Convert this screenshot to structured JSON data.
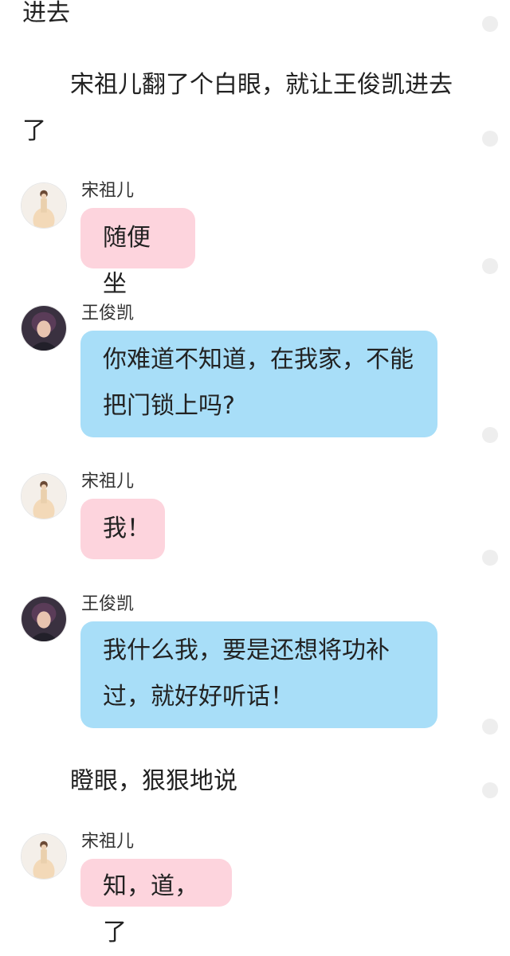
{
  "narration": [
    "进去",
    "宋祖儿翻了个白眼，就让王俊凯进去",
    "了",
    "瞪眼，狠狠地说"
  ],
  "messages": [
    {
      "speaker": "宋祖儿",
      "text": "随便坐"
    },
    {
      "speaker": "王俊凯",
      "text_lines": [
        "你难道不知道，在我家，不能",
        "把门锁上吗?"
      ]
    },
    {
      "speaker": "宋祖儿",
      "text": "我！"
    },
    {
      "speaker": "王俊凯",
      "text_lines": [
        "我什么我，要是还想将功补",
        "过，就好好听话！"
      ]
    },
    {
      "speaker": "宋祖儿",
      "text": "知，道，了"
    }
  ],
  "colors": {
    "pink_bubble": "#fdd4dd",
    "blue_bubble": "#a8def8",
    "text": "#222222",
    "scroll_dot": "#eeeeee"
  },
  "icons": {
    "female_avatar": "avatar-songzuer",
    "male_avatar": "avatar-wangjunkai"
  }
}
